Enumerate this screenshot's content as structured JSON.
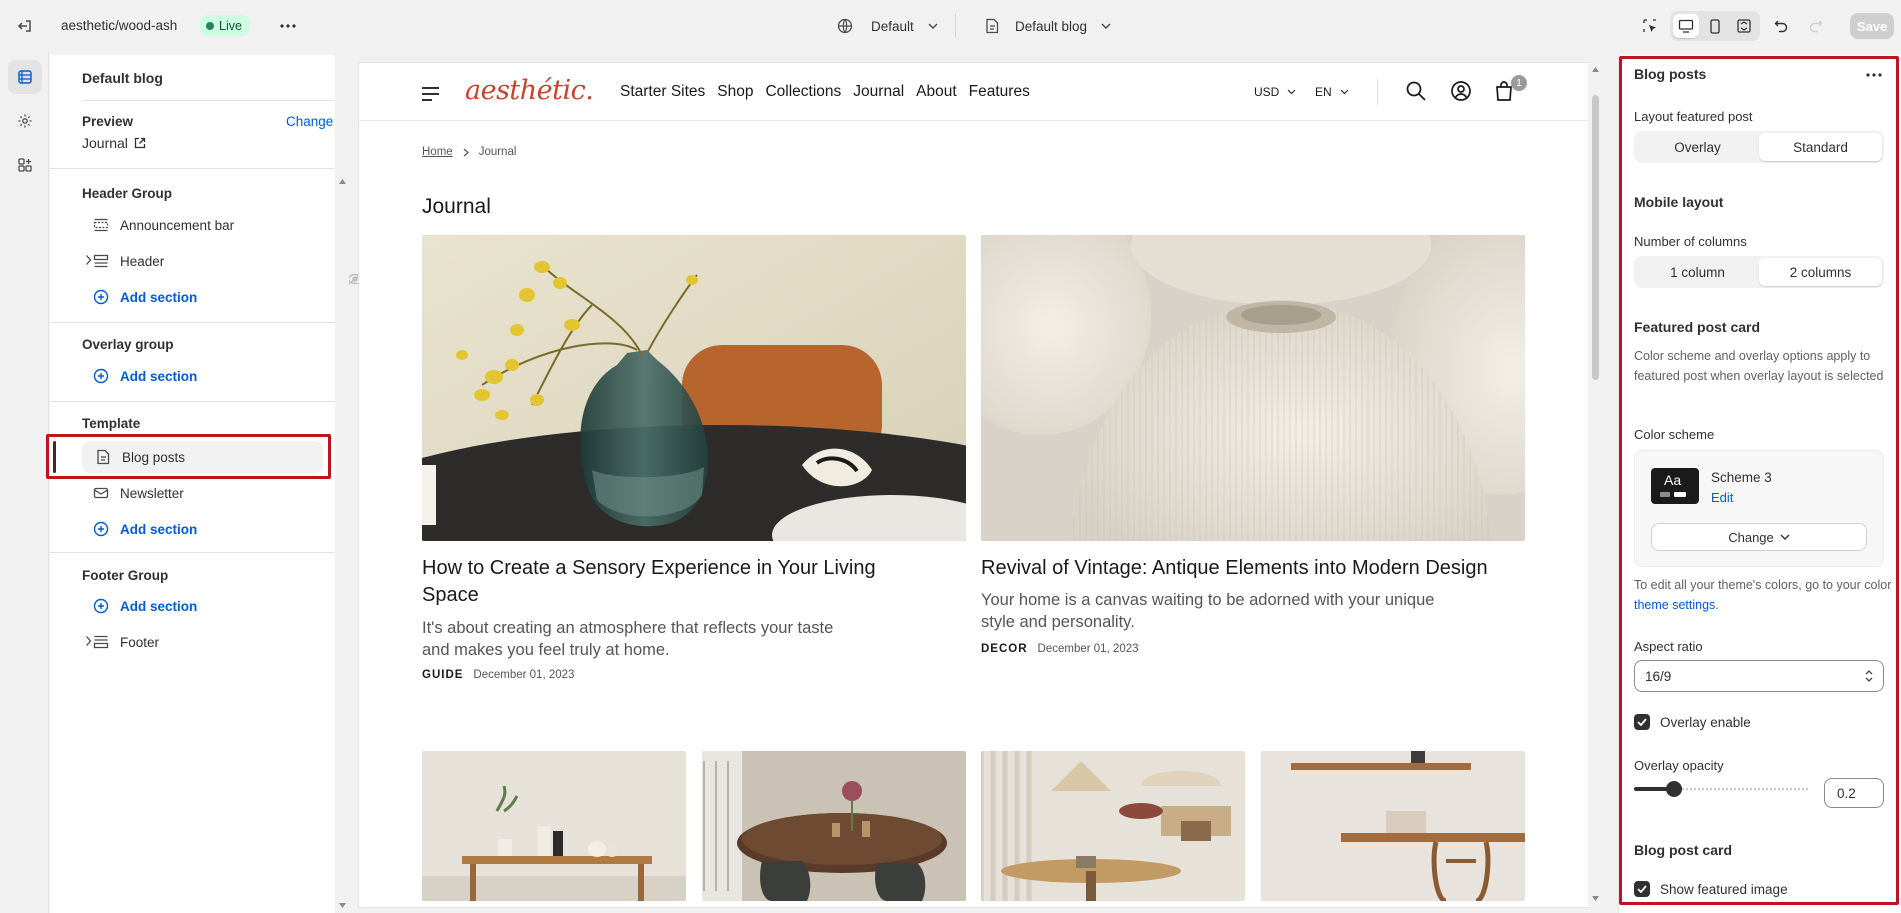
{
  "topbar": {
    "store_name": "aesthetic/wood-ash",
    "live_label": "Live",
    "theme_select": "Default",
    "template_select": "Default blog",
    "save_label": "Save"
  },
  "sidebar": {
    "title": "Default blog",
    "preview_label": "Preview",
    "change_label": "Change",
    "preview_value": "Journal",
    "header_group": {
      "label": "Header Group",
      "items": [
        "Announcement bar",
        "Header"
      ],
      "add": "Add section"
    },
    "overlay_group": {
      "label": "Overlay group",
      "add": "Add section"
    },
    "template": {
      "label": "Template",
      "items": [
        "Blog posts",
        "Newsletter"
      ],
      "add": "Add section"
    },
    "footer_group": {
      "label": "Footer Group",
      "add": "Add section",
      "items": [
        "Footer"
      ]
    }
  },
  "site": {
    "logo": "aesthétic.",
    "nav": [
      "Starter Sites",
      "Shop",
      "Collections",
      "Journal",
      "About",
      "Features"
    ],
    "currency": "USD",
    "language": "EN",
    "cart_count": "1",
    "breadcrumb": [
      "Home",
      "Journal"
    ],
    "page_title": "Journal",
    "posts": [
      {
        "title": "How to Create a Sensory Experience in Your Living Space",
        "excerpt": "It's about creating an atmosphere that reflects your taste and makes you feel truly at home.",
        "tag": "GUIDE",
        "date": "December 01, 2023"
      },
      {
        "title": "Revival of Vintage: Antique Elements into Modern Design",
        "excerpt": "Your home is a canvas waiting to be adorned with your unique style and personality.",
        "tag": "DECOR",
        "date": "December 01, 2023"
      }
    ]
  },
  "panel": {
    "title": "Blog posts",
    "layout_featured_label": "Layout featured post",
    "layout_options": [
      "Overlay",
      "Standard"
    ],
    "layout_selected": "Standard",
    "mobile_layout_heading": "Mobile layout",
    "columns_label": "Number of columns",
    "columns_options": [
      "1 column",
      "2 columns"
    ],
    "columns_selected": "2 columns",
    "featured_card_heading": "Featured post card",
    "featured_card_help": "Color scheme and overlay options apply to featured post when overlay layout is selected",
    "color_scheme_label": "Color scheme",
    "scheme_swatch": "Aa",
    "scheme_name": "Scheme 3",
    "scheme_edit": "Edit",
    "scheme_change": "Change",
    "theme_help_prefix": "To edit all your theme's colors, go to your color",
    "theme_help_link": "theme settings",
    "theme_help_suffix": ".",
    "aspect_label": "Aspect ratio",
    "aspect_value": "16/9",
    "overlay_enable": "Overlay enable",
    "overlay_opacity_label": "Overlay opacity",
    "overlay_opacity": "0.2",
    "overlay_opacity_fraction": 0.2,
    "blog_card_heading": "Blog post card",
    "show_featured_image": "Show featured image"
  },
  "colors": {
    "accent_blue": "#005bd3",
    "highlight_red": "#c0141c",
    "logo": "#c6422d",
    "live_bg": "#cdfee1"
  }
}
